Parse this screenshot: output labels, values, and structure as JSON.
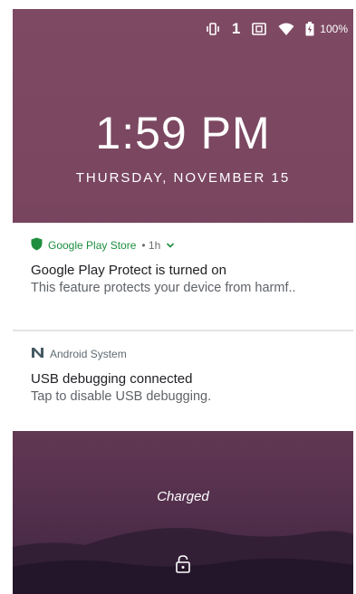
{
  "status_bar": {
    "icons": [
      "vibrate-icon",
      "notification-count",
      "nfc-icon",
      "wifi-icon",
      "battery-icon"
    ],
    "notification_count": "1",
    "battery_percent": "100%"
  },
  "lockscreen": {
    "time": "1:59 PM",
    "date": "THURSDAY, NOVEMBER 15",
    "charging_status": "Charged"
  },
  "notifications": [
    {
      "app": "Google Play Store",
      "meta": "• 1h",
      "icon": "shield-icon",
      "title": "Google Play Protect is turned on",
      "text": "This feature protects your device from harmf.."
    },
    {
      "app": "Android System",
      "icon": "android-n-icon",
      "title": "USB debugging connected",
      "text": "Tap to disable USB debugging."
    }
  ],
  "colors": {
    "play_green": "#1e8e3e",
    "wallpaper_top": "#7e4a63",
    "wallpaper_bottom": "#3e2540"
  }
}
